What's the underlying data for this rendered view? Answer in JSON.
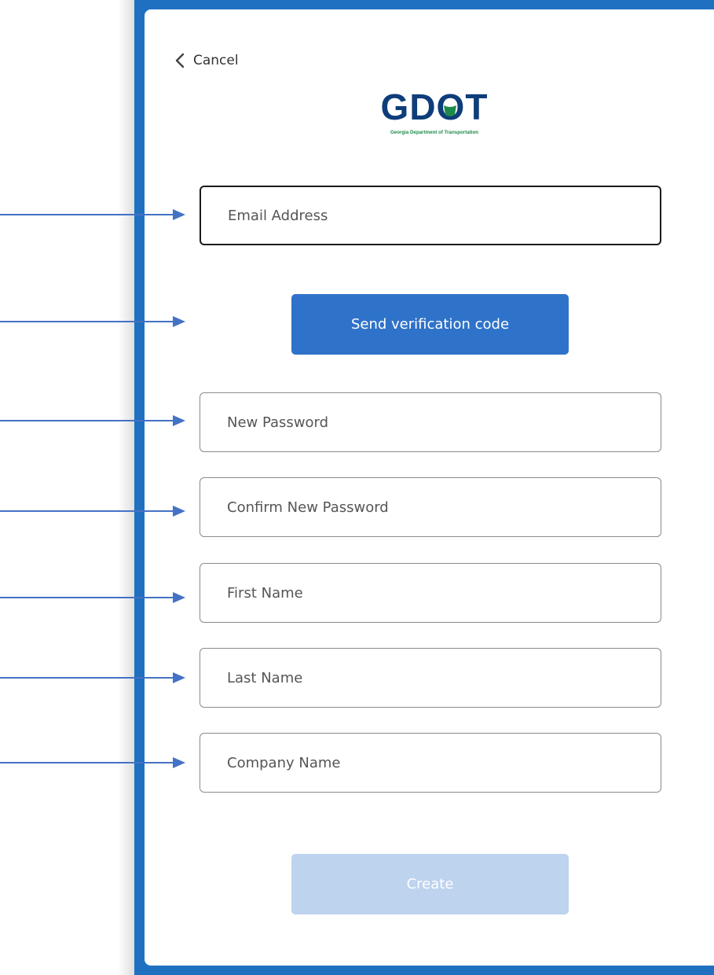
{
  "nav": {
    "cancel_label": "Cancel"
  },
  "logo": {
    "text": "GDOT",
    "tagline": "Georgia Department of Transportation"
  },
  "form": {
    "email_placeholder": "Email Address",
    "send_code_label": "Send verification code",
    "new_password_placeholder": "New Password",
    "confirm_password_placeholder": "Confirm New Password",
    "first_name_placeholder": "First Name",
    "last_name_placeholder": "Last Name",
    "company_placeholder": "Company Name",
    "create_label": "Create"
  },
  "colors": {
    "frame_blue": "#1f70c1",
    "button_blue": "#2f72c9",
    "disabled_button": "#bdd3ee",
    "arrow_blue": "#4472c4",
    "logo_navy": "#0e3d7a",
    "logo_green": "#1e8a4a"
  },
  "icons": [
    "chevron-left-icon",
    "annotation-arrow-icon"
  ]
}
